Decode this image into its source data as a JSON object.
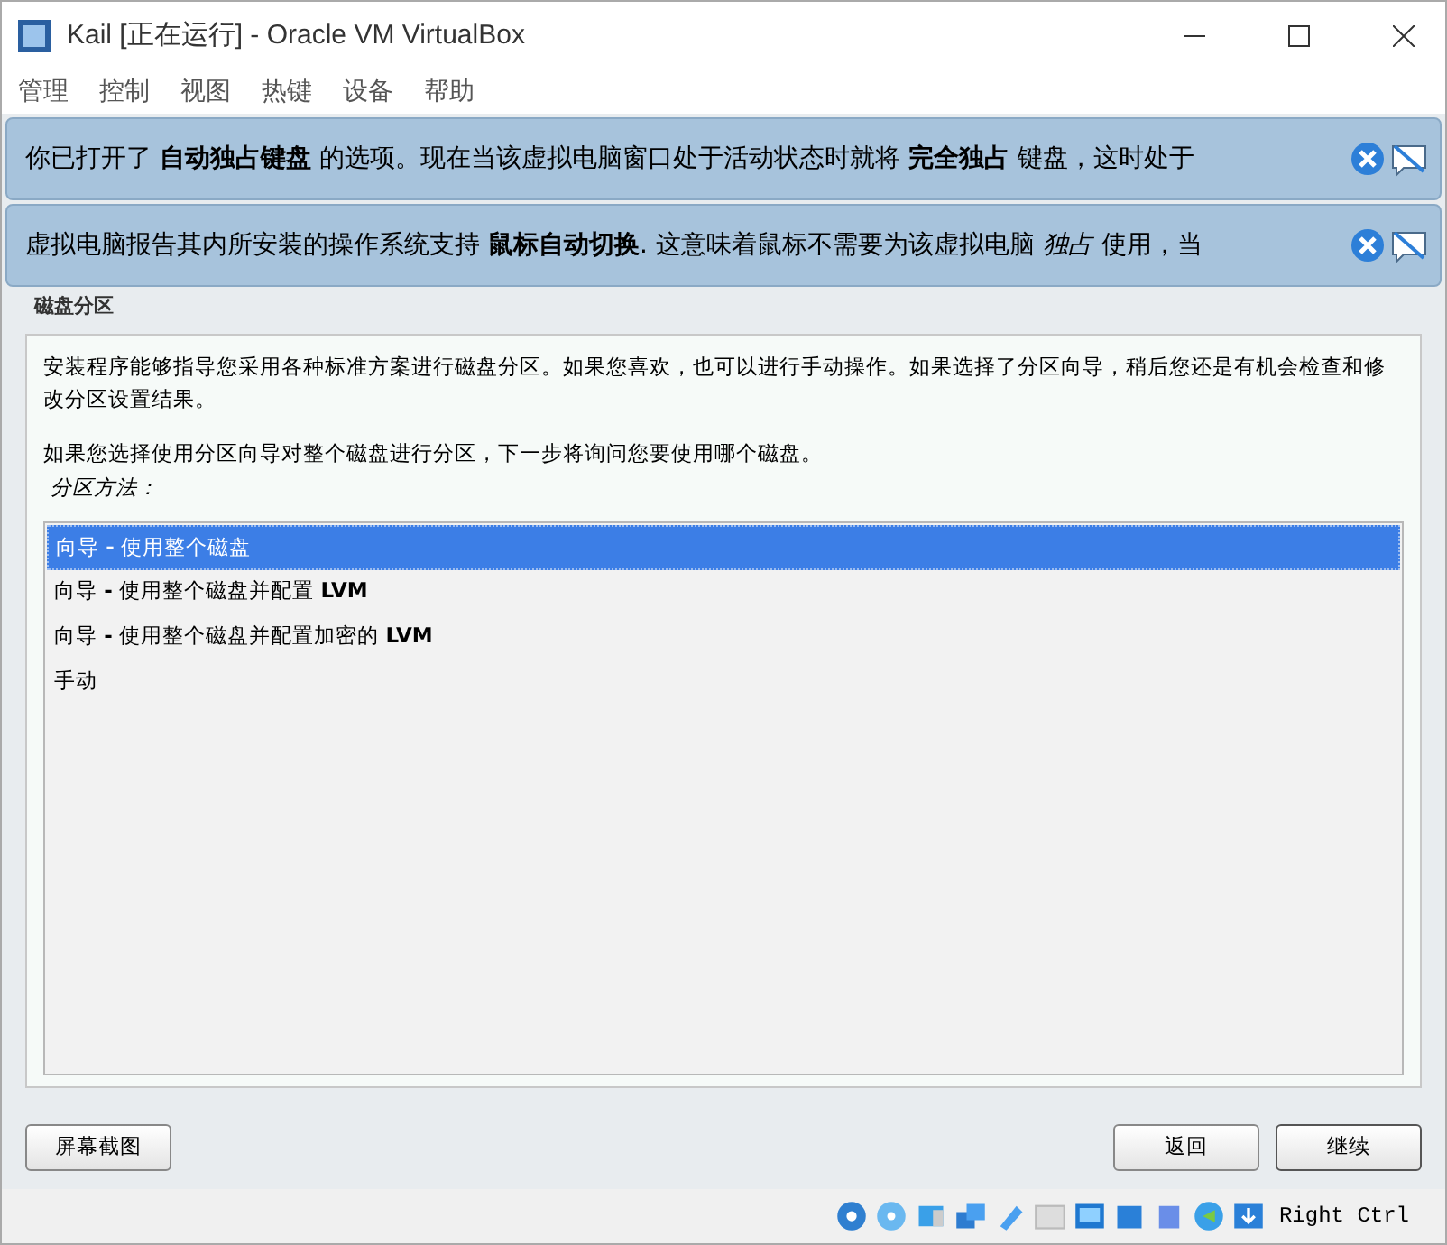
{
  "window": {
    "title": "Kail [正在运行] - Oracle VM VirtualBox"
  },
  "menu": [
    "管理",
    "控制",
    "视图",
    "热键",
    "设备",
    "帮助"
  ],
  "notices": [
    {
      "text": "你已打开了 **自动独占键盘** 的选项。现在当该虚拟电脑窗口处于活动状态时就将 **完全独占** 键盘，这时处于"
    },
    {
      "text": "虚拟电脑报告其内所安装的操作系统支持 **鼠标自动切换**. 这意味着鼠标不需要为该虚拟电脑 *独占* 使用，当"
    }
  ],
  "section_title": "磁盘分区",
  "description": [
    "安装程序能够指导您采用各种标准方案进行磁盘分区。如果您喜欢，也可以进行手动操作。如果选择了分区向导，稍后您还是有机会检查和修改分区设置结果。",
    "如果您选择使用分区向导对整个磁盘进行分区，下一步将询问您要使用哪个磁盘。"
  ],
  "list_label": "分区方法：",
  "options": [
    {
      "text": "向导 **-** 使用整个磁盘",
      "selected": true
    },
    {
      "text": "向导 **-** 使用整个磁盘并配置 **LVM**",
      "selected": false
    },
    {
      "text": "向导 **-** 使用整个磁盘并配置加密的 **LVM**",
      "selected": false
    },
    {
      "text": "手动",
      "selected": false
    }
  ],
  "buttons": {
    "screenshot": "屏幕截图",
    "back": "返回",
    "continue": "继续"
  },
  "status_bar": {
    "host_key": "Right Ctrl"
  }
}
